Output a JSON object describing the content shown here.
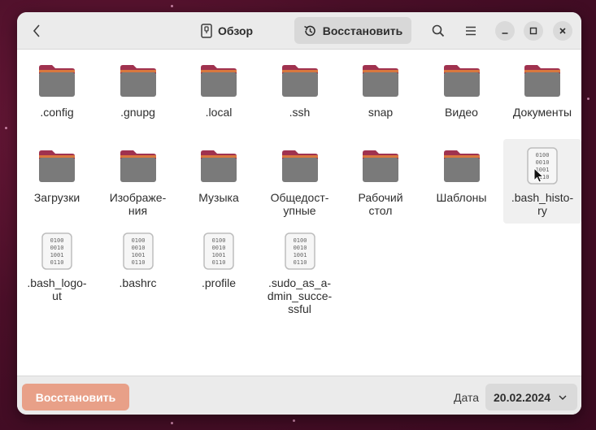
{
  "header": {
    "back_icon": "chevron-left-icon",
    "title": "Обзор",
    "restore_toggle_label": "Восстановить",
    "search_icon": "search-icon",
    "menu_icon": "hamburger-menu-icon"
  },
  "items": [
    {
      "label": ".config",
      "type": "folder"
    },
    {
      "label": ".gnupg",
      "type": "folder"
    },
    {
      "label": ".local",
      "type": "folder"
    },
    {
      "label": ".ssh",
      "type": "folder"
    },
    {
      "label": "snap",
      "type": "folder"
    },
    {
      "label": "Видео",
      "type": "folder"
    },
    {
      "label": "Документы",
      "type": "folder"
    },
    {
      "label": "Загрузки",
      "type": "folder"
    },
    {
      "label": "Изображе-\nния",
      "type": "folder"
    },
    {
      "label": "Музыка",
      "type": "folder"
    },
    {
      "label": "Общедост-\nупные",
      "type": "folder"
    },
    {
      "label": "Рабочий\nстол",
      "type": "folder"
    },
    {
      "label": "Шаблоны",
      "type": "folder"
    },
    {
      "label": ".bash_histo-\nry",
      "type": "file",
      "selected": true
    },
    {
      "label": ".bash_logo-\nut",
      "type": "file"
    },
    {
      "label": ".bashrc",
      "type": "file"
    },
    {
      "label": ".profile",
      "type": "file"
    },
    {
      "label": ".sudo_as_a-\ndmin_succe-\nssful",
      "type": "file"
    }
  ],
  "bottom": {
    "restore_button": "Восстановить",
    "date_label": "Дата",
    "date_value": "20.02.2024"
  },
  "colors": {
    "folder_body": "#7a7a7a",
    "folder_tab": "#a0324f",
    "restore_button": "#e8a088"
  }
}
